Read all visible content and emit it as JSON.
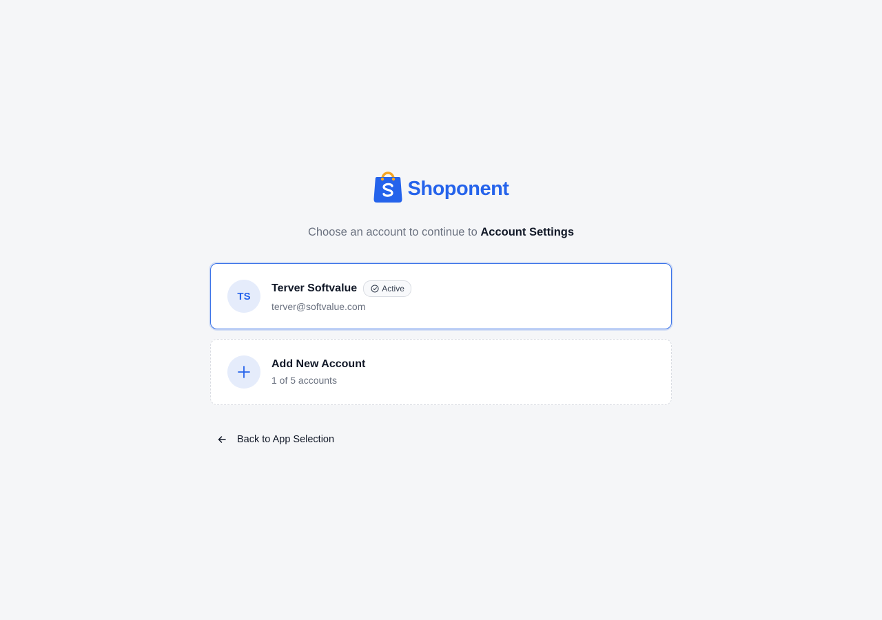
{
  "brand": {
    "logo_icon": "shopping-bag-logo-icon",
    "name": "Shoponent",
    "accent_color": "#2563eb",
    "handle_color": "#f5a524"
  },
  "subtitle": {
    "prefix": "Choose an account to continue to",
    "target": "Account Settings"
  },
  "accounts": [
    {
      "initials": "TS",
      "name": "Terver Softvalue",
      "email": "terver@softvalue.com",
      "status": "Active",
      "status_icon": "check-circle-icon",
      "selected": true
    }
  ],
  "add_account": {
    "icon": "plus-icon",
    "label": "Add New Account",
    "count_text": "1 of 5 accounts"
  },
  "back": {
    "icon": "arrow-left-icon",
    "label": "Back to App Selection"
  }
}
